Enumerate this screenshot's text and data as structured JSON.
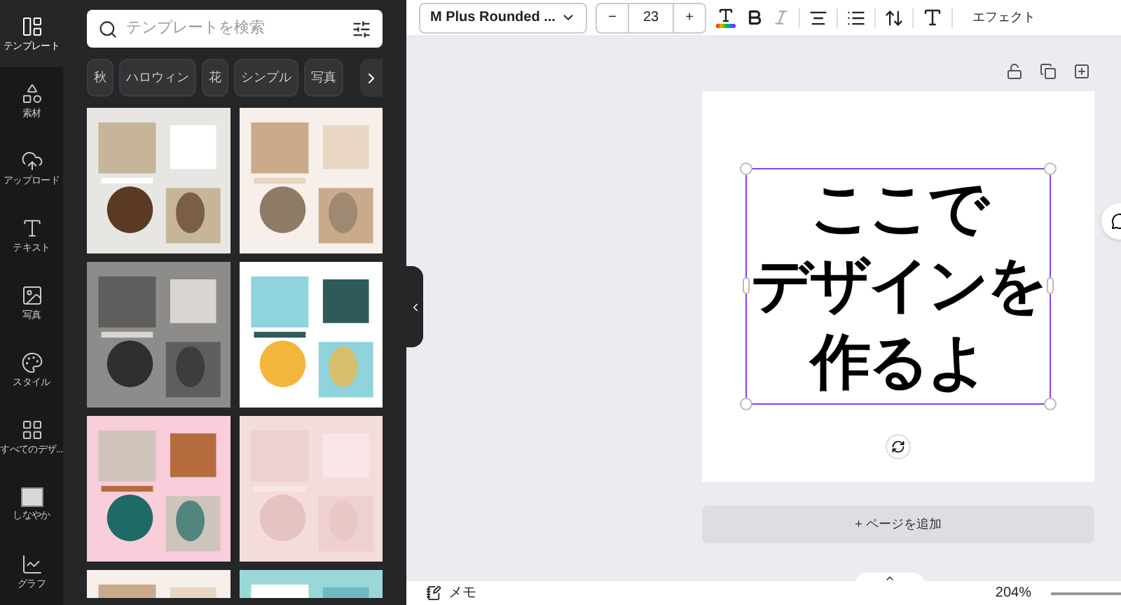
{
  "sidebar": {
    "items": [
      {
        "label": "テンプレート",
        "selected": true
      },
      {
        "label": "素材",
        "selected": false
      },
      {
        "label": "アップロード",
        "selected": false
      },
      {
        "label": "テキスト",
        "selected": false
      },
      {
        "label": "写真",
        "selected": false
      },
      {
        "label": "スタイル",
        "selected": false
      },
      {
        "label": "すべてのデザ...",
        "selected": false
      },
      {
        "label": "しなやか",
        "selected": false
      },
      {
        "label": "グラフ",
        "selected": false
      }
    ]
  },
  "panel": {
    "search": {
      "placeholder": "テンプレートを検索"
    },
    "chips": [
      "秋",
      "ハロウィン",
      "花",
      "シンプル",
      "写真"
    ]
  },
  "toolbar": {
    "font": "M Plus Rounded ...",
    "size_minus": "−",
    "font_size": "23",
    "size_plus": "+",
    "effects": "エフェクト"
  },
  "canvas": {
    "text_lines": [
      "ここで",
      "デザインを",
      "作るよ"
    ],
    "add_page": "+ ページを追加"
  },
  "footer": {
    "notes": "メモ",
    "zoom": "204%"
  }
}
